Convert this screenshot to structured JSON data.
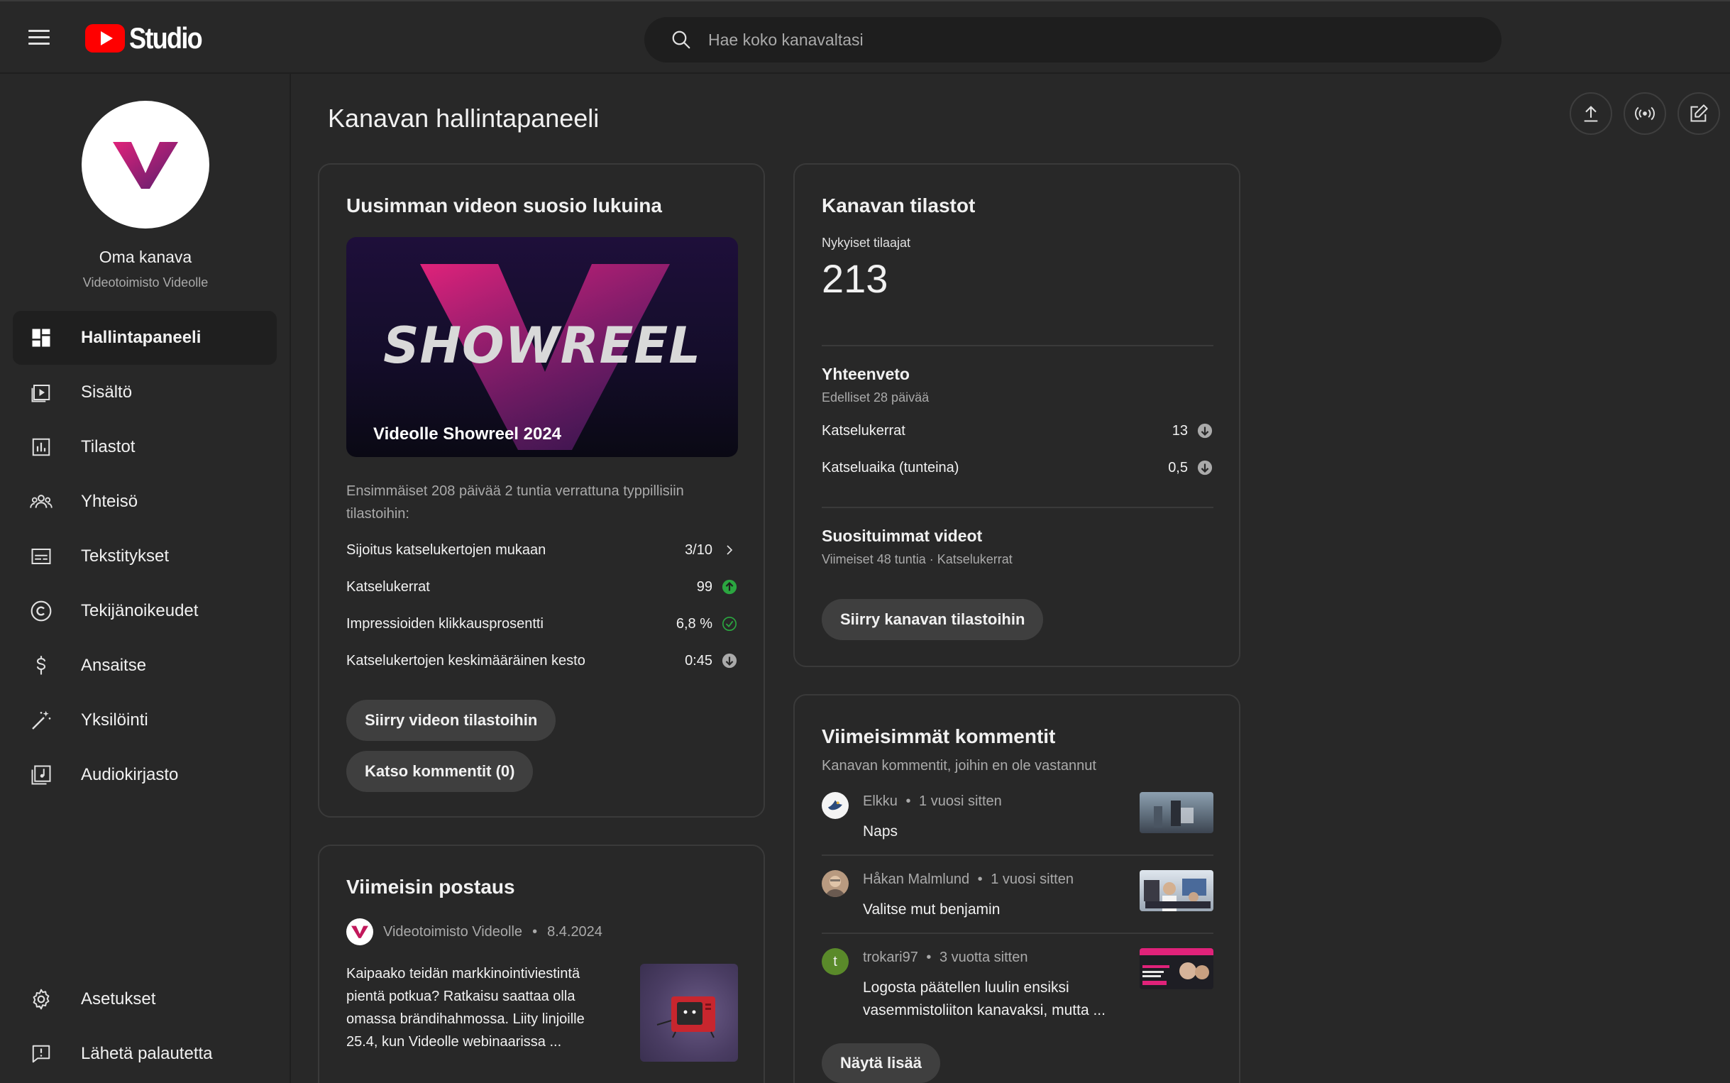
{
  "topbar": {
    "logo_text": "Studio",
    "search_placeholder": "Hae koko kanavaltasi"
  },
  "sidebar": {
    "channel_name": "Oma kanava",
    "channel_sub": "Videotoimisto Videolle",
    "items": [
      {
        "label": "Hallintapaneeli",
        "icon": "dashboard-icon",
        "active": true
      },
      {
        "label": "Sisältö",
        "icon": "content-icon"
      },
      {
        "label": "Tilastot",
        "icon": "analytics-icon"
      },
      {
        "label": "Yhteisö",
        "icon": "community-icon"
      },
      {
        "label": "Tekstitykset",
        "icon": "subtitles-icon"
      },
      {
        "label": "Tekijänoikeudet",
        "icon": "copyright-icon"
      },
      {
        "label": "Ansaitse",
        "icon": "earn-icon"
      },
      {
        "label": "Yksilöinti",
        "icon": "customization-icon"
      },
      {
        "label": "Audiokirjasto",
        "icon": "audio-library-icon"
      }
    ],
    "bottom_items": [
      {
        "label": "Asetukset",
        "icon": "settings-icon"
      },
      {
        "label": "Lähetä palautetta",
        "icon": "feedback-icon"
      }
    ]
  },
  "main": {
    "title": "Kanavan hallintapaneeli",
    "actions": [
      "upload-icon",
      "live-icon",
      "create-post-icon"
    ]
  },
  "latest_video": {
    "title": "Uusimman videon suosio lukuina",
    "thumb_overlay": "SHOWREEL",
    "video_title": "Videolle Showreel 2024",
    "description": "Ensimmäiset 208 päivää 2 tuntia verrattuna typpillisiin tilastoihin:",
    "rows": [
      {
        "label": "Sijoitus katselukertojen mukaan",
        "value": "3/10",
        "icon": "chevron-right-icon"
      },
      {
        "label": "Katselukerrat",
        "value": "99",
        "icon": "arrow-up-green-icon"
      },
      {
        "label": "Impressioiden klikkausprosentti",
        "value": "6,8 %",
        "icon": "check-circle-icon"
      },
      {
        "label": "Katselukertojen keskimääräinen kesto",
        "value": "0:45",
        "icon": "arrow-down-grey-icon"
      }
    ],
    "button_stats": "Siirry videon tilastoihin",
    "button_comments": "Katso kommentit (0)"
  },
  "channel_stats": {
    "title": "Kanavan tilastot",
    "subscribers_label": "Nykyiset tilaajat",
    "subscribers": "213",
    "summary_title": "Yhteenveto",
    "summary_period": "Edelliset 28 päivää",
    "rows": [
      {
        "label": "Katselukerrat",
        "value": "13",
        "icon": "arrow-down-grey-icon"
      },
      {
        "label": "Katseluaika (tunteina)",
        "value": "0,5",
        "icon": "arrow-down-grey-icon"
      }
    ],
    "top_videos_title": "Suosituimmat videot",
    "top_videos_sub": "Viimeiset 48 tuntia · Katselukerrat",
    "button": "Siirry kanavan tilastoihin"
  },
  "latest_post": {
    "title": "Viimeisin postaus",
    "author": "Videotoimisto Videolle",
    "date": "8.4.2024",
    "text": "Kaipaako teidän markkinointiviestintä pientä potkua? Ratkaisu saattaa olla omassa brändihahmossa. Liity linjoille 25.4, kun Videolle webinaarissa ..."
  },
  "comments": {
    "title": "Viimeisimmät kommentit",
    "subtitle": "Kanavan kommentit, joihin en ole vastannut",
    "items": [
      {
        "author": "Elkku",
        "time": "1 vuosi sitten",
        "text": "Naps",
        "avatar_letter": ""
      },
      {
        "author": "Håkan Malmlund",
        "time": "1 vuosi sitten",
        "text": "Valitse mut benjamin",
        "avatar_letter": ""
      },
      {
        "author": "trokari97",
        "time": "3 vuotta sitten",
        "text": "Logosta päätellen luulin ensiksi vasemmistoliiton kanavaksi, mutta ...",
        "avatar_letter": "t"
      }
    ],
    "separator": "•",
    "button": "Näytä lisää"
  },
  "colors": {
    "background": "#282828",
    "accent_red": "#ff0000",
    "brand_magenta": "#c2185b",
    "success_green": "#2ba640"
  }
}
